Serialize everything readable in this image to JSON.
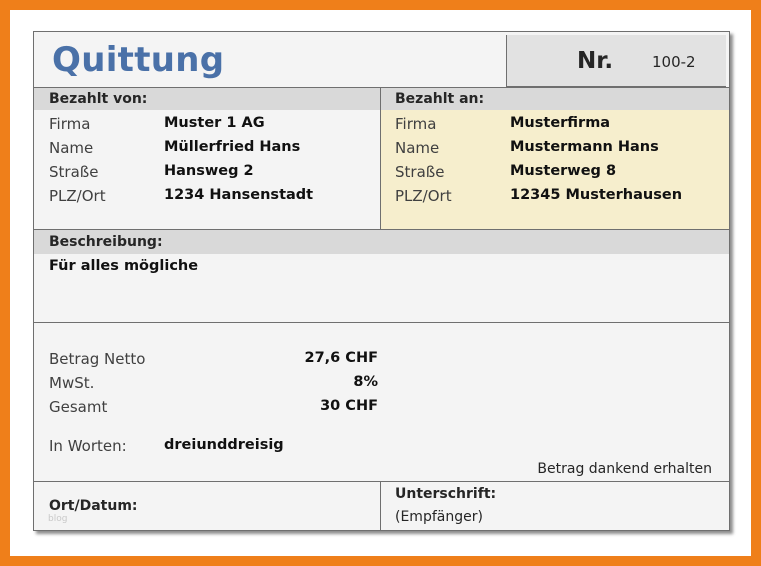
{
  "title": "Quittung",
  "nr_label": "Nr.",
  "nr_value": "100-2",
  "paid_by": {
    "heading": "Bezahlt von:",
    "firma_label": "Firma",
    "firma": "Muster 1 AG",
    "name_label": "Name",
    "name": "Müllerfried Hans",
    "strasse_label": "Straße",
    "strasse": "Hansweg 2",
    "plz_label": "PLZ/Ort",
    "plz": "1234 Hansenstadt"
  },
  "paid_to": {
    "heading": "Bezahlt an:",
    "firma_label": "Firma",
    "firma": "Musterfirma",
    "name_label": "Name",
    "name": "Mustermann Hans",
    "strasse_label": "Straße",
    "strasse": "Musterweg 8",
    "plz_label": "PLZ/Ort",
    "plz": "12345 Musterhausen"
  },
  "description": {
    "heading": "Beschreibung:",
    "text": "Für alles mögliche"
  },
  "amounts": {
    "netto_label": "Betrag Netto",
    "netto": "27,6 CHF",
    "mwst_label": "MwSt.",
    "mwst": "8%",
    "gesamt_label": "Gesamt",
    "gesamt": "30 CHF",
    "words_label": "In Worten:",
    "words": "dreiunddreisig"
  },
  "received_text": "Betrag dankend erhalten",
  "footer": {
    "ort_datum": "Ort/Datum:",
    "unterschrift": "Unterschrift:",
    "empfaenger": "(Empfänger)",
    "watermark": "blog"
  },
  "colors": {
    "frame": "#ef7f1a",
    "title": "#4a71a8",
    "band": "#d9d9d9",
    "highlight": "#f6eecd"
  }
}
